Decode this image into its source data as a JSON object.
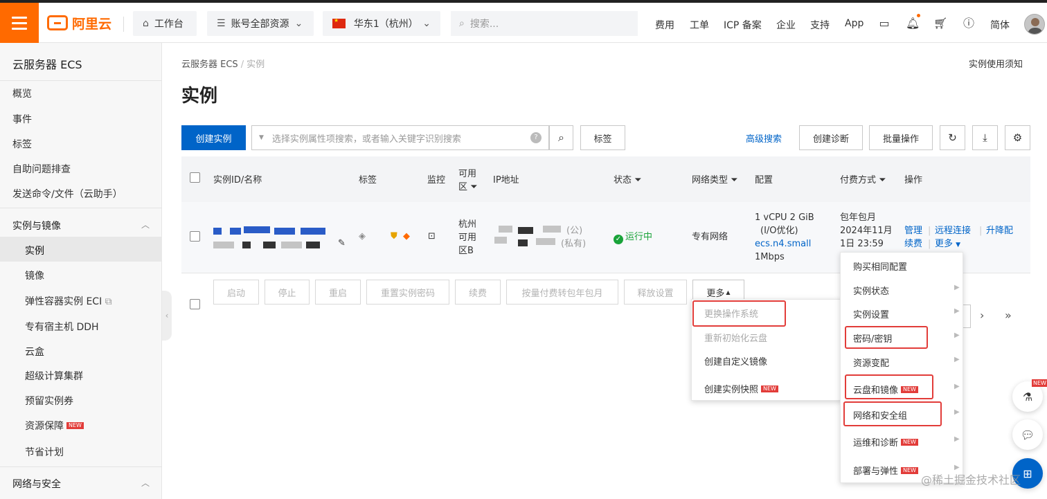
{
  "topbar": {
    "logo_text": "阿里云",
    "workbench": "工作台",
    "resources": "账号全部资源",
    "region": "华东1（杭州）",
    "search_placeholder": "搜索...",
    "nav": [
      "费用",
      "工单",
      "ICP 备案",
      "企业",
      "支持",
      "App"
    ],
    "lang": "简体",
    "accent_color": "#ff6a00"
  },
  "sidebar": {
    "title": "云服务器 ECS",
    "top_items": [
      "概览",
      "事件",
      "标签",
      "自助问题排查",
      "发送命令/文件（云助手）"
    ],
    "group1_title": "实例与镜像",
    "group1_items": [
      "实例",
      "镜像",
      "弹性容器实例 ECI",
      "专有宿主机 DDH",
      "云盒",
      "超级计算集群",
      "预留实例券",
      "资源保障",
      "节省计划"
    ],
    "group2_title": "网络与安全",
    "new_badge": "NEW"
  },
  "breadcrumb": {
    "root": "云服务器 ECS",
    "current": "实例"
  },
  "notice_link": "实例使用须知",
  "page_title": "实例",
  "toolbar": {
    "create": "创建实例",
    "search_placeholder": "选择实例属性项搜索，或者输入关键字识别搜索",
    "tags": "标签",
    "advanced": "高级搜索",
    "diagnose": "创建诊断",
    "batch": "批量操作"
  },
  "table": {
    "headers": {
      "id": "实例ID/名称",
      "tag": "标签",
      "monitor": "监控",
      "zone_l1": "可用",
      "zone_l2": "区",
      "ip": "IP地址",
      "status": "状态",
      "network": "网络类型",
      "config": "配置",
      "billing": "付费方式",
      "ops": "操作"
    },
    "row": {
      "zone": [
        "杭州",
        "可用",
        "区B"
      ],
      "ip_public_label": "(公)",
      "ip_private_label": "(私有)",
      "status": "运行中",
      "network": "专有网络",
      "config": [
        "1 vCPU 2 GiB",
        "(I/O优化)",
        "ecs.n4.small",
        "1Mbps"
      ],
      "billing": [
        "包年包月",
        "2024年11月",
        "1日 23:59"
      ],
      "ops": [
        "管理",
        "远程连接",
        "升降配",
        "续费",
        "更多"
      ]
    }
  },
  "bottom_actions": [
    "启动",
    "停止",
    "重启",
    "重置实例密码",
    "续费",
    "按量付费转包年包月",
    "释放设置",
    "更多"
  ],
  "more_menu_left": [
    {
      "label": "更换操作系统",
      "disabled": true
    },
    {
      "label": "重新初始化云盘",
      "disabled": true
    },
    {
      "label": "创建自定义镜像",
      "disabled": false
    },
    {
      "label": "创建实例快照",
      "disabled": false,
      "new": true
    }
  ],
  "more_menu_right": [
    {
      "label": "购买相同配置"
    },
    {
      "label": "实例状态"
    },
    {
      "label": "实例设置"
    },
    {
      "label": "密码/密钥"
    },
    {
      "label": "资源变配"
    },
    {
      "label": "云盘和镜像",
      "new": true
    },
    {
      "label": "网络和安全组"
    },
    {
      "label": "运维和诊断",
      "new": true
    },
    {
      "label": "部署与弹性",
      "new": true
    }
  ],
  "watermark": "@稀土掘金技术社区",
  "float_new": "NEW"
}
